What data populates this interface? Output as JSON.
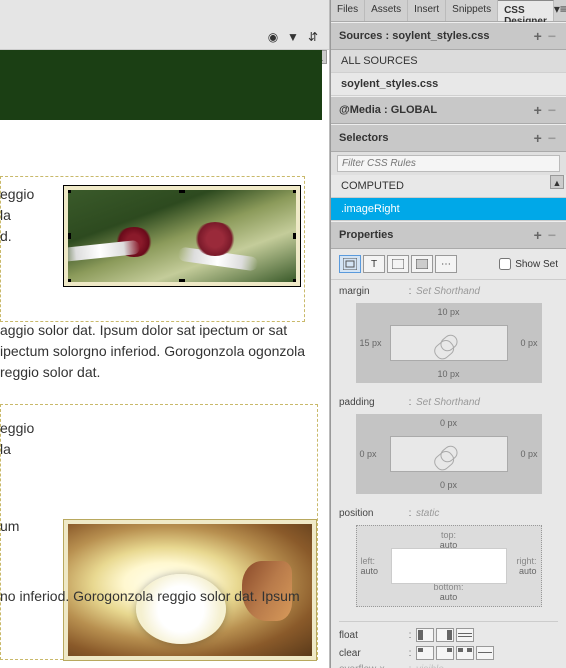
{
  "tabs": {
    "items": [
      "Files",
      "Assets",
      "Insert",
      "Snippets",
      "CSS Designer"
    ],
    "active": "CSS Designer"
  },
  "sources": {
    "header": "Sources :",
    "file": "soylent_styles.css",
    "all": "ALL SOURCES",
    "selected": "soylent_styles.css"
  },
  "media": {
    "header": "@Media :",
    "value": "GLOBAL"
  },
  "selectors": {
    "header": "Selectors",
    "filter_placeholder": "Filter CSS Rules",
    "computed": "COMPUTED",
    "selected": ".imageRight"
  },
  "properties": {
    "header": "Properties",
    "showset_label": "Show Set",
    "margin": {
      "label": "margin",
      "shorthand": "Set Shorthand",
      "top": "10 px",
      "right": "0 px",
      "bottom": "10 px",
      "left": "15 px"
    },
    "padding": {
      "label": "padding",
      "shorthand": "Set Shorthand",
      "top": "0 px",
      "right": "0 px",
      "bottom": "0 px",
      "left": "0 px"
    },
    "position": {
      "label": "position",
      "value": "static",
      "top_label": "top:",
      "top": "auto",
      "right_label": "right:",
      "right": "auto",
      "bottom_label": "bottom:",
      "bottom": "auto",
      "left_label": "left:",
      "left": "auto"
    },
    "float": {
      "label": "float"
    },
    "clear": {
      "label": "clear"
    },
    "overflowx": {
      "label": "overflow-x",
      "value": "visible"
    }
  },
  "editor": {
    "text1a": "eggio",
    "text1b": "la",
    "text1c": "d.",
    "para": "aggio solor dat. Ipsum dolor sat ipectum or sat ipectum solorgno inferiod. Gorogonzola ogonzola reggio solor dat.",
    "text2a": "eggio",
    "text2b": "la",
    "text2c": "um",
    "para2": "no inferiod. Gorogonzola reggio solor dat. Ipsum"
  },
  "toolbar": {
    "globe": "◉",
    "filter": "▼",
    "sort": "⇵"
  }
}
